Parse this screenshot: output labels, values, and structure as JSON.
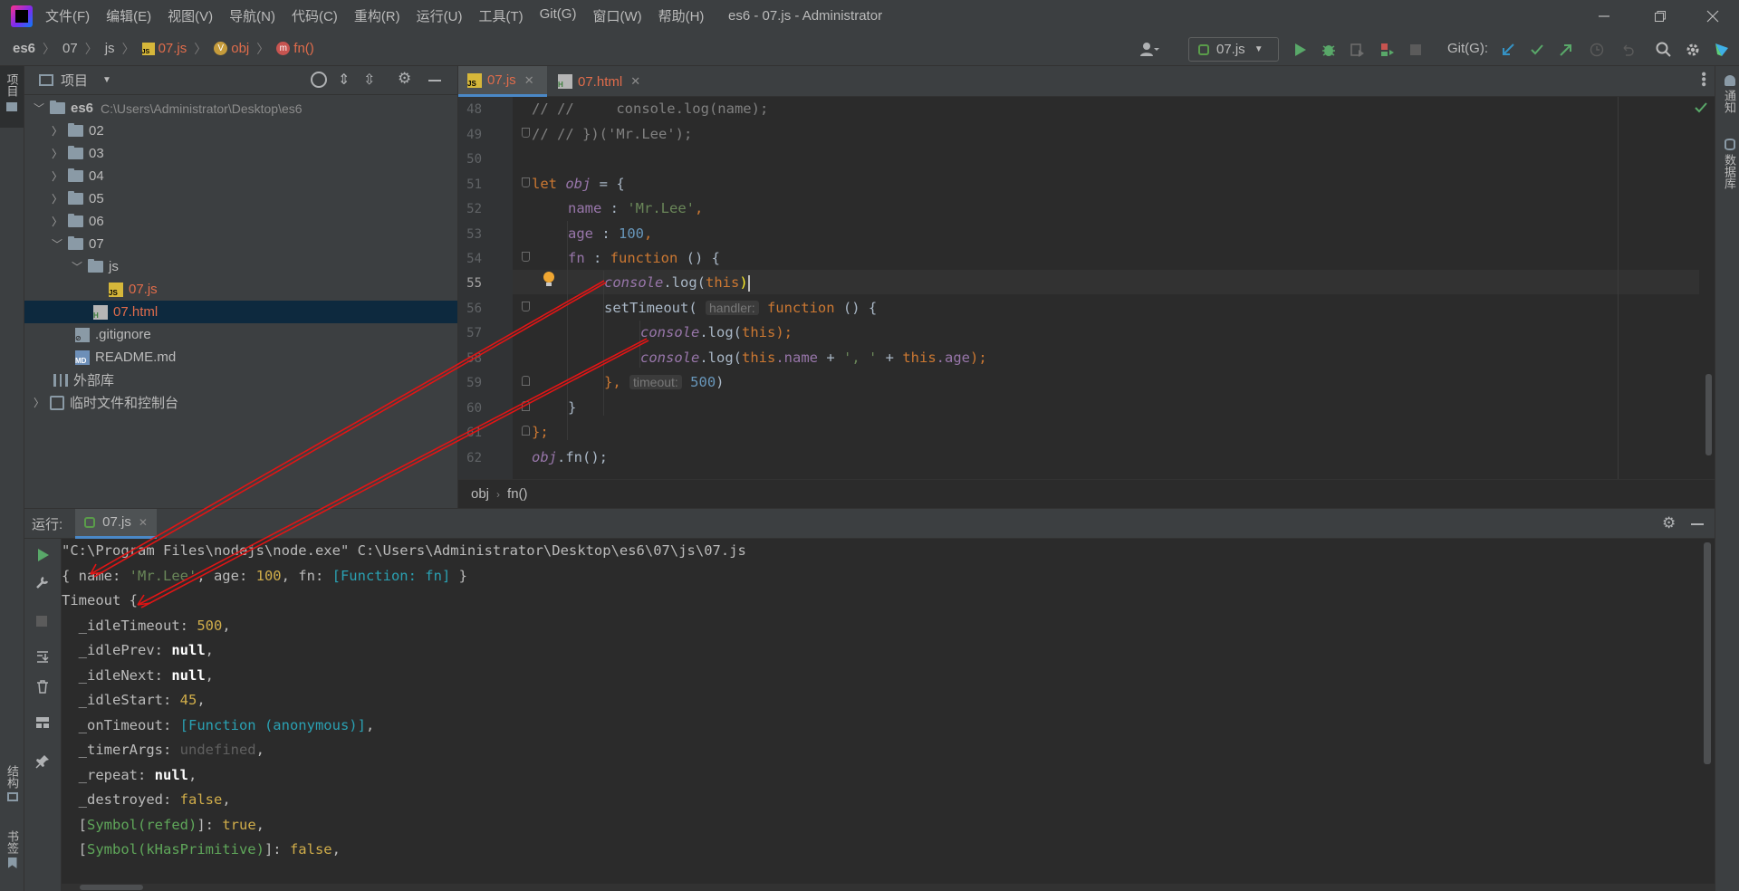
{
  "window": {
    "menu": [
      "文件(F)",
      "编辑(E)",
      "视图(V)",
      "导航(N)",
      "代码(C)",
      "重构(R)",
      "运行(U)",
      "工具(T)",
      "Git(G)",
      "窗口(W)",
      "帮助(H)"
    ],
    "title": "es6 - 07.js - Administrator"
  },
  "navbar": {
    "crumbs": [
      "es6",
      "07",
      "js",
      "07.js",
      "obj",
      "fn()"
    ],
    "run_config": "07.js",
    "git_label": "Git(G):"
  },
  "left_strip": {
    "project_label": "项目",
    "structure_label": "结构",
    "bookmarks_label": "书签"
  },
  "right_strip": {
    "notifications_label": "通知",
    "database_label": "数据库"
  },
  "project": {
    "title": "项目",
    "root_name": "es6",
    "root_path": "C:\\Users\\Administrator\\Desktop\\es6",
    "items": [
      {
        "label": "02"
      },
      {
        "label": "03"
      },
      {
        "label": "04"
      },
      {
        "label": "05"
      },
      {
        "label": "06"
      },
      {
        "label": "07"
      },
      {
        "label": "js"
      },
      {
        "label": "07.js"
      },
      {
        "label": "07.html"
      },
      {
        "label": ".gitignore"
      },
      {
        "label": "README.md"
      },
      {
        "label": "外部库"
      },
      {
        "label": "临时文件和控制台"
      }
    ]
  },
  "editor": {
    "tabs": [
      {
        "label": "07.js"
      },
      {
        "label": "07.html"
      }
    ],
    "line_numbers": [
      "48",
      "49",
      "50",
      "51",
      "52",
      "53",
      "54",
      "55",
      "56",
      "57",
      "58",
      "59",
      "60",
      "61",
      "62"
    ],
    "hint_handler": "handler:",
    "hint_timeout": "timeout:",
    "code": {
      "l48": "// //     console.log(name);",
      "l49": "// // })('Mr.Lee');",
      "l51_kw": "let ",
      "l51_var": "obj",
      "l51_rest": " = {",
      "l52_prop": "name",
      "l52_mid": " : ",
      "l52_str": "'Mr.Lee'",
      "l52_end": ",",
      "l53_prop": "age",
      "l53_mid": " : ",
      "l53_num": "100",
      "l53_end": ",",
      "l54_prop": "fn",
      "l54_mid": " : ",
      "l54_kw": "function",
      "l54_end": " () {",
      "l55_obj": "console",
      "l55_dot": ".log(",
      "l55_kw": "this",
      "l55_end": ")",
      "l56_fn": "setTimeout(",
      "l56_kw": "function",
      "l56_end": " () {",
      "l57_obj": "console",
      "l57_dot": ".log(",
      "l57_kw": "this",
      "l57_end": ");",
      "l58_obj": "console",
      "l58_dot": ".log(",
      "l58_kw1": "this",
      "l58_p1": ".name",
      "l58_plus1": " + ",
      "l58_str": "', '",
      "l58_plus2": " + ",
      "l58_kw2": "this",
      "l58_p2": ".age",
      "l58_end": ");",
      "l59_start": "}, ",
      "l59_num": "500",
      "l59_end": ")",
      "l60": "}",
      "l61": "};",
      "l62_var": "obj",
      "l62_rest": ".fn();"
    },
    "crumbs": [
      "obj",
      "fn()"
    ]
  },
  "run": {
    "label": "运行:",
    "tab": "07.js",
    "console": {
      "l1": "\"C:\\Program Files\\nodejs\\node.exe\" C:\\Users\\Administrator\\Desktop\\es6\\07\\js\\07.js",
      "l2_a": "{ name: ",
      "l2_str": "'Mr.Lee'",
      "l2_b": ", age: ",
      "l2_num": "100",
      "l2_c": ", fn: ",
      "l2_fn": "[Function: fn]",
      "l2_d": " }",
      "l3": "Timeout {",
      "l4_k": "  _idleTimeout: ",
      "l4_v": "500",
      "l4_e": ",",
      "l5_k": "  _idlePrev: ",
      "l5_v": "null",
      "l5_e": ",",
      "l6_k": "  _idleNext: ",
      "l6_v": "null",
      "l6_e": ",",
      "l7_k": "  _idleStart: ",
      "l7_v": "45",
      "l7_e": ",",
      "l8_k": "  _onTimeout: ",
      "l8_v": "[Function (anonymous)]",
      "l8_e": ",",
      "l9_k": "  _timerArgs: ",
      "l9_v": "undefined",
      "l9_e": ",",
      "l10_k": "  _repeat: ",
      "l10_v": "null",
      "l10_e": ",",
      "l11_k": "  _destroyed: ",
      "l11_v": "false",
      "l11_e": ",",
      "l12_o": "  [",
      "l12_s": "Symbol(refed)",
      "l12_c": "]: ",
      "l12_v": "true",
      "l12_e": ",",
      "l13_o": "  [",
      "l13_s": "Symbol(kHasPrimitive)",
      "l13_c": "]: ",
      "l13_v": "false",
      "l13_e": ","
    }
  },
  "colors": {
    "accent": "#4a88c7",
    "annotation_arrow": "#e01515",
    "run_green": "#59a869"
  }
}
